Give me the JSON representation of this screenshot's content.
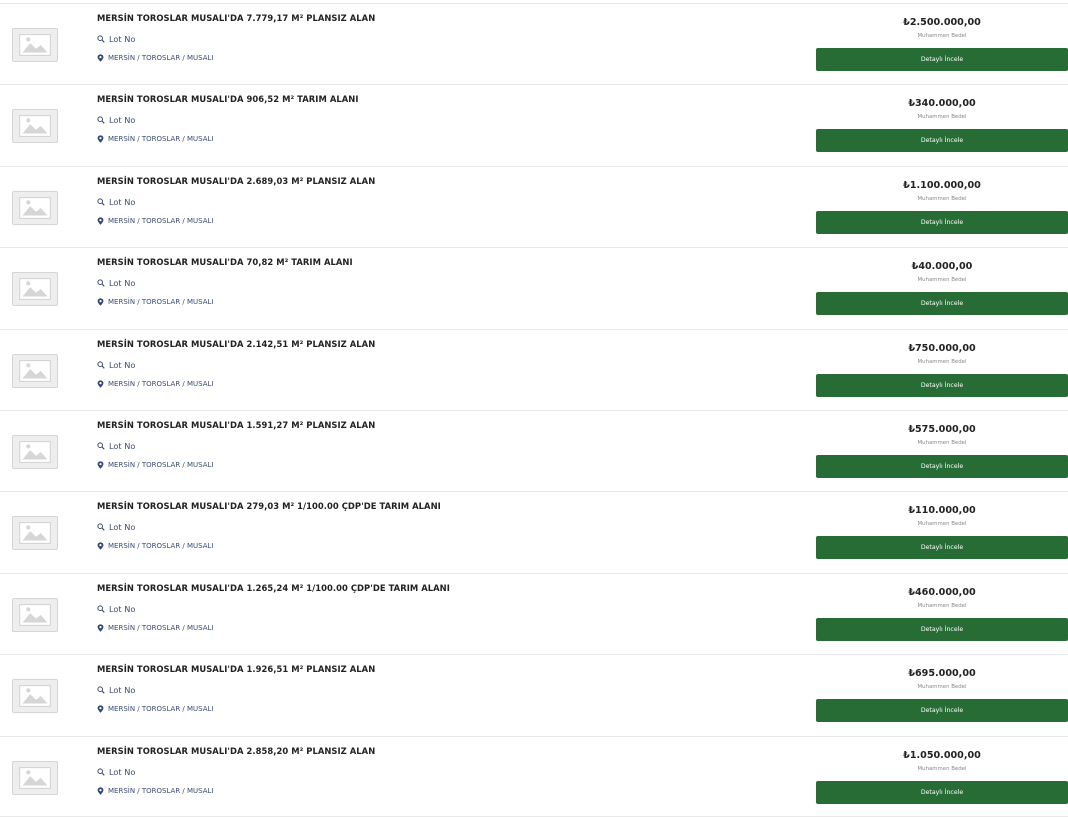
{
  "listings": [
    {
      "title": "MERSİN TOROSLAR MUSALI'DA 7.779,17 M² PLANSIZ ALAN",
      "lot_label": "Lot No",
      "location": "MERSİN / TOROSLAR / MUSALI",
      "price": "₺2.500.000,00",
      "price_label": "Muhammen Bedel",
      "button_label": "Detaylı İncele"
    },
    {
      "title": "MERSİN TOROSLAR MUSALI'DA 906,52 M² TARIM ALANI",
      "lot_label": "Lot No",
      "location": "MERSİN / TOROSLAR / MUSALI",
      "price": "₺340.000,00",
      "price_label": "Muhammen Bedel",
      "button_label": "Detaylı İncele"
    },
    {
      "title": "MERSİN TOROSLAR MUSALI'DA 2.689,03 M² PLANSIZ ALAN",
      "lot_label": "Lot No",
      "location": "MERSİN / TOROSLAR / MUSALI",
      "price": "₺1.100.000,00",
      "price_label": "Muhammen Bedel",
      "button_label": "Detaylı İncele"
    },
    {
      "title": "MERSİN TOROSLAR MUSALI'DA 70,82 M² TARIM ALANI",
      "lot_label": "Lot No",
      "location": "MERSİN / TOROSLAR / MUSALI",
      "price": "₺40.000,00",
      "price_label": "Muhammen Bedel",
      "button_label": "Detaylı İncele"
    },
    {
      "title": "MERSİN TOROSLAR MUSALI'DA 2.142,51 M² PLANSIZ ALAN",
      "lot_label": "Lot No",
      "location": "MERSİN / TOROSLAR / MUSALI",
      "price": "₺750.000,00",
      "price_label": "Muhammen Bedel",
      "button_label": "Detaylı İncele"
    },
    {
      "title": "MERSİN TOROSLAR MUSALI'DA 1.591,27 M² PLANSIZ ALAN",
      "lot_label": "Lot No",
      "location": "MERSİN / TOROSLAR / MUSALI",
      "price": "₺575.000,00",
      "price_label": "Muhammen Bedel",
      "button_label": "Detaylı İncele"
    },
    {
      "title": "MERSİN TOROSLAR MUSALI'DA 279,03 M² 1/100.00 ÇDP'DE TARIM ALANI",
      "lot_label": "Lot No",
      "location": "MERSİN / TOROSLAR / MUSALI",
      "price": "₺110.000,00",
      "price_label": "Muhammen Bedel",
      "button_label": "Detaylı İncele"
    },
    {
      "title": "MERSİN TOROSLAR MUSALI'DA 1.265,24 M² 1/100.00 ÇDP'DE TARIM ALANI",
      "lot_label": "Lot No",
      "location": "MERSİN / TOROSLAR / MUSALI",
      "price": "₺460.000,00",
      "price_label": "Muhammen Bedel",
      "button_label": "Detaylı İncele"
    },
    {
      "title": "MERSİN TOROSLAR MUSALI'DA 1.926,51 M² PLANSIZ ALAN",
      "lot_label": "Lot No",
      "location": "MERSİN / TOROSLAR / MUSALI",
      "price": "₺695.000,00",
      "price_label": "Muhammen Bedel",
      "button_label": "Detaylı İncele"
    },
    {
      "title": "MERSİN TOROSLAR MUSALI'DA 2.858,20 M² PLANSIZ ALAN",
      "lot_label": "Lot No",
      "location": "MERSİN / TOROSLAR / MUSALI",
      "price": "₺1.050.000,00",
      "price_label": "Muhammen Bedel",
      "button_label": "Detaylı İncele"
    }
  ],
  "icons": {
    "thumbnail": "image-placeholder-icon",
    "lot": "search-icon",
    "location": "map-pin-icon"
  },
  "colors": {
    "button": "#276c35",
    "button_text": "#ffffff",
    "meta_text": "#3a4c6e"
  }
}
